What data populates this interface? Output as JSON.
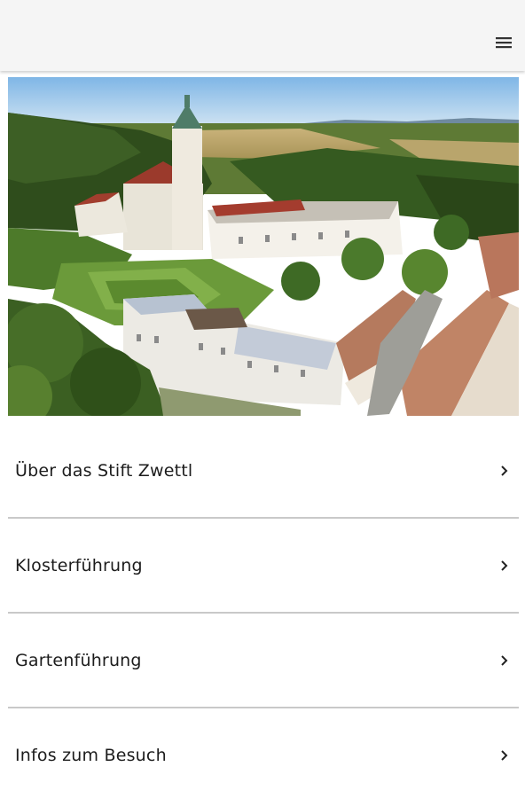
{
  "header": {
    "menu_icon": "hamburger-menu-icon"
  },
  "hero_image": {
    "subject": "aerial-view-stift-zwettl"
  },
  "menu": {
    "items": [
      {
        "label": "Über das Stift Zwettl",
        "icon": "chevron-right-icon"
      },
      {
        "label": "Klosterführung",
        "icon": "chevron-right-icon"
      },
      {
        "label": "Gartenführung",
        "icon": "chevron-right-icon"
      },
      {
        "label": "Infos zum Besuch",
        "icon": "chevron-right-icon"
      }
    ]
  },
  "colors": {
    "topbar": "#f5f5f5",
    "divider": "#c9c9c9",
    "text": "#1c1c1c"
  }
}
